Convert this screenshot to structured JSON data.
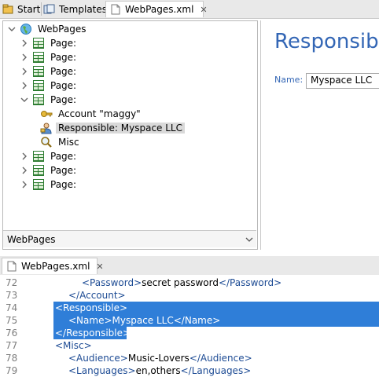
{
  "top_tabs": [
    {
      "label": "Start",
      "icon": "home-icon"
    },
    {
      "label": "Templates",
      "icon": "templates-icon"
    },
    {
      "label": "WebPages.xml",
      "icon": "document-icon",
      "active": true,
      "close": "✕"
    }
  ],
  "tree": {
    "root": "WebPages",
    "items": [
      {
        "label": "Page:",
        "expanded": false
      },
      {
        "label": "Page:",
        "expanded": false
      },
      {
        "label": "Page:",
        "expanded": false
      },
      {
        "label": "Page:",
        "expanded": false
      },
      {
        "label": "Page:",
        "expanded": true
      },
      {
        "label": "Account \"maggy\"",
        "child": true,
        "icon": "key-icon"
      },
      {
        "label": "Responsible: Myspace LLC",
        "child": true,
        "icon": "person-icon",
        "selected": true
      },
      {
        "label": "Misc",
        "child": true,
        "icon": "magnifier-icon"
      },
      {
        "label": "Page:",
        "expanded": false
      },
      {
        "label": "Page:",
        "expanded": false
      },
      {
        "label": "Page:",
        "expanded": false
      }
    ]
  },
  "combo": {
    "value": "WebPages"
  },
  "form": {
    "title": "Responsible",
    "name_label": "Name:",
    "name_value": "Myspace LLC"
  },
  "editor_tab": {
    "label": "WebPages.xml",
    "close": "✕"
  },
  "editor": {
    "lines": [
      {
        "num": "72",
        "indent": 2,
        "parts": [
          [
            "tag",
            "<Password>"
          ],
          [
            "text",
            "secret password"
          ],
          [
            "tag",
            "</Password>"
          ]
        ]
      },
      {
        "num": "73",
        "indent": 1,
        "parts": [
          [
            "tag",
            "</Account>"
          ]
        ]
      },
      {
        "num": "74",
        "indent": 0,
        "parts": [
          [
            "tag",
            "<Responsible>"
          ]
        ],
        "highlight": true
      },
      {
        "num": "75",
        "indent": 1,
        "parts": [
          [
            "tag",
            "<Name>"
          ],
          [
            "text",
            "Myspace LLC"
          ],
          [
            "tag",
            "</Name>"
          ]
        ],
        "highlight": true
      },
      {
        "num": "76",
        "indent": 0,
        "parts": [
          [
            "tag",
            "</Responsible>"
          ]
        ],
        "highlight": true
      },
      {
        "num": "77",
        "indent": 0,
        "parts": [
          [
            "tag",
            "<Misc>"
          ]
        ]
      },
      {
        "num": "78",
        "indent": 1,
        "parts": [
          [
            "tag",
            "<Audience>"
          ],
          [
            "text",
            "Music-Lovers"
          ],
          [
            "tag",
            "</Audience>"
          ]
        ]
      },
      {
        "num": "79",
        "indent": 1,
        "parts": [
          [
            "tag",
            "<Languages>"
          ],
          [
            "text",
            "en,others"
          ],
          [
            "tag",
            "</Languages>"
          ]
        ]
      }
    ]
  }
}
